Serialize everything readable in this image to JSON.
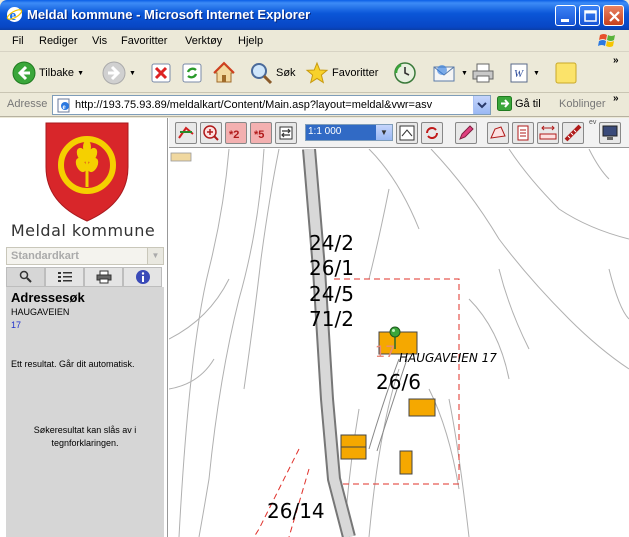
{
  "window": {
    "title": "Meldal kommune - Microsoft Internet Explorer"
  },
  "menu": {
    "items": [
      {
        "label": "Fil",
        "name": "menu-fil"
      },
      {
        "label": "Rediger",
        "name": "menu-rediger"
      },
      {
        "label": "Vis",
        "name": "menu-vis"
      },
      {
        "label": "Favoritter",
        "name": "menu-favoritter"
      },
      {
        "label": "Verktøy",
        "name": "menu-verktoy"
      },
      {
        "label": "Hjelp",
        "name": "menu-hjelp"
      }
    ]
  },
  "toolbar": {
    "back_label": "Tilbake",
    "search_label": "Søk",
    "favorites_label": "Favoritter"
  },
  "address": {
    "label": "Adresse",
    "url": "http://193.75.93.89/meldalkart/Content/Main.asp?layout=meldal&vwr=asv",
    "go_label": "Gå til",
    "links_label": "Koblinger"
  },
  "sidebar": {
    "municipality_name": "Meldal kommune",
    "map_select_value": "Standardkart",
    "panel": {
      "heading": "Adressesøk",
      "street": "HAUGAVEIEN",
      "number": "17",
      "result_text": "Ett resultat. Går dit automatisk.",
      "note_text": "Søkeresultat kan slås av i tegnforklaringen."
    }
  },
  "map_toolbar": {
    "scale_value": "1:1 000",
    "ev_label": "ev"
  },
  "map": {
    "parcel_block": [
      "24/2",
      "26/1",
      "24/5",
      "71/2"
    ],
    "parcel_26_6": "26/6",
    "parcel_26_14": "26/14",
    "address_label": "HAUGAVEIEN 17",
    "ghost_number": "17"
  },
  "colors": {
    "building": "#f5a800",
    "boundary": "#e0302a",
    "title_bar": "#0a56d8"
  }
}
